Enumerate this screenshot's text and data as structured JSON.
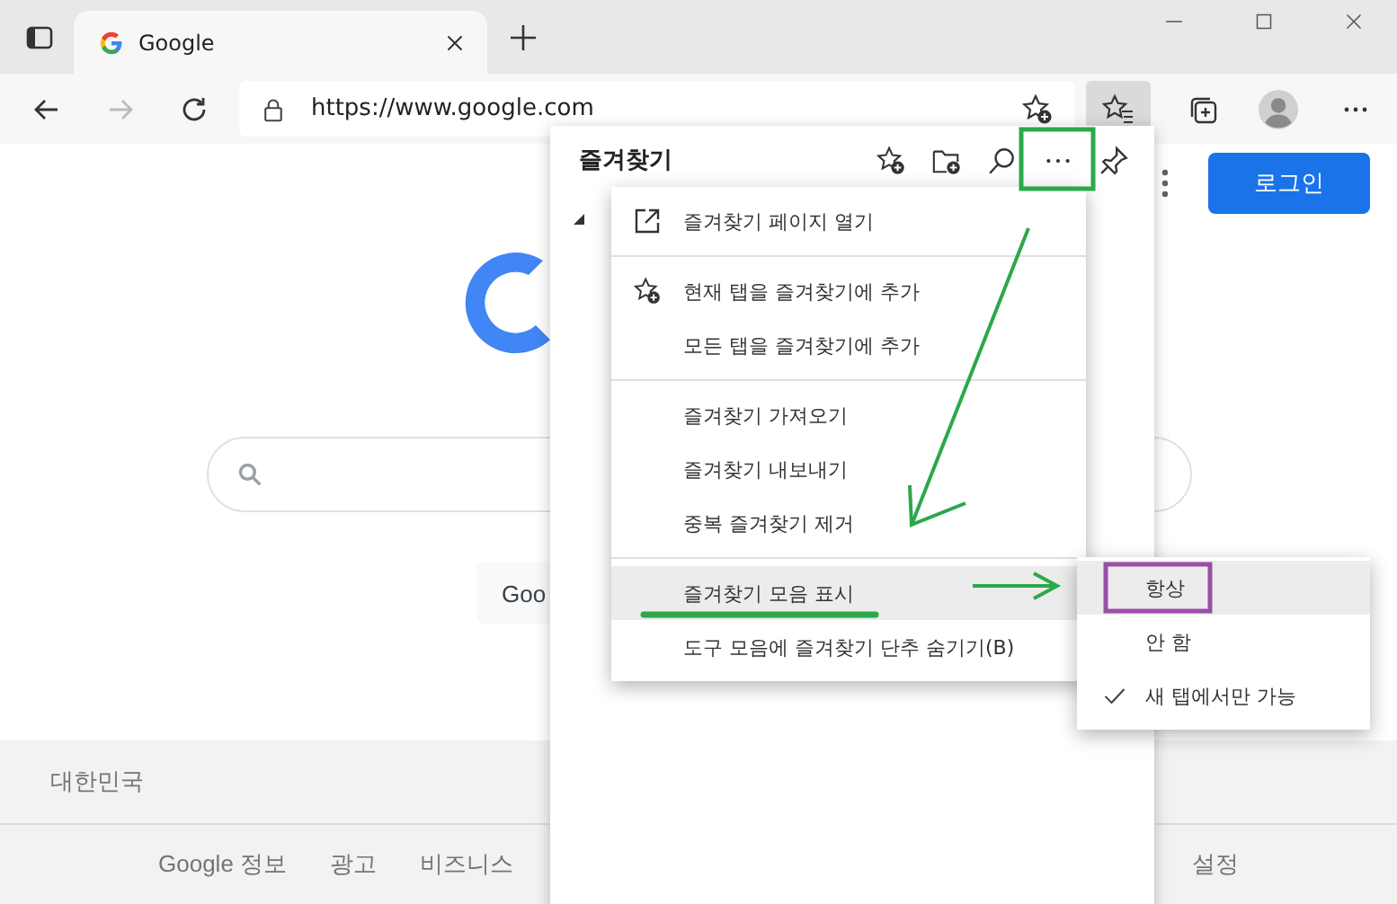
{
  "tab": {
    "title": "Google",
    "selected": true
  },
  "address": {
    "url": "https://www.google.com"
  },
  "page": {
    "login": "로그인",
    "search_button": "Goo",
    "country": "대한민국",
    "footer_links": [
      "Google 정보",
      "광고",
      "비즈니스"
    ],
    "footer_right": [
      "설정"
    ]
  },
  "favorites": {
    "title": "즐겨찾기",
    "folder_expanded": true
  },
  "menu": {
    "groups": [
      [
        {
          "label": "즐겨찾기 페이지 열기",
          "kind": "open",
          "selected": false
        }
      ],
      [
        {
          "label": "현재 탭을 즐겨찾기에 추가",
          "kind": "star-add",
          "selected": false
        },
        {
          "label": "모든 탭을 즐겨찾기에 추가",
          "kind": "plain",
          "selected": false
        }
      ],
      [
        {
          "label": "즐겨찾기 가져오기",
          "kind": "plain",
          "selected": false
        },
        {
          "label": "즐겨찾기 내보내기",
          "kind": "plain",
          "selected": false
        },
        {
          "label": "중복 즐겨찾기 제거",
          "kind": "plain",
          "selected": false
        }
      ],
      [
        {
          "label": "즐겨찾기 모음 표시",
          "kind": "plain",
          "selected": true
        },
        {
          "label": "도구 모음에 즐겨찾기 단추 숨기기(B)",
          "kind": "plain",
          "selected": false
        }
      ]
    ]
  },
  "submenu": {
    "items": [
      {
        "label": "항상",
        "selected": true,
        "checked": false
      },
      {
        "label": "안 함",
        "selected": false,
        "checked": false
      },
      {
        "label": "새 탭에서만 가능",
        "selected": false,
        "checked": true
      }
    ]
  }
}
